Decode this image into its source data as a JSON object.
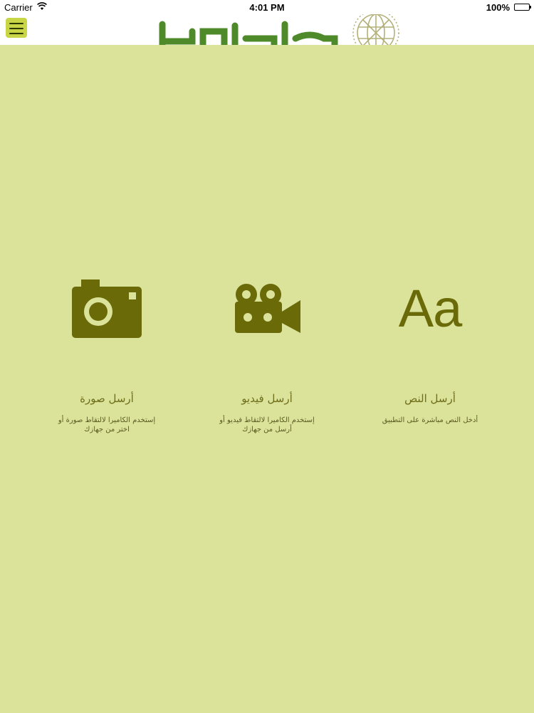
{
  "status_bar": {
    "carrier": "Carrier",
    "time": "4:01 PM",
    "battery": "100%"
  },
  "header": {
    "menu_icon": "hamburger-menu-icon",
    "logo_icon": "globe-logo-icon"
  },
  "colors": {
    "background": "#dbe39b",
    "icon": "#6a6a08",
    "menu_button": "#c7d546",
    "logo_green": "#4e8a2a"
  },
  "tiles": [
    {
      "icon": "camera-icon",
      "title": "أرسل صورة",
      "description": "إستخدم الكاميرا لالتقاط صورة أو اختر من جهازك"
    },
    {
      "icon": "video-camera-icon",
      "title": "أرسل فيديو",
      "description": "إستخدم الكاميرا لالتقاط فيديو أو أرسل من جهازك"
    },
    {
      "icon": "text-icon",
      "icon_text": "Aa",
      "title": "أرسل النص",
      "description": "أدخل النص مباشرة على التطبيق"
    }
  ]
}
